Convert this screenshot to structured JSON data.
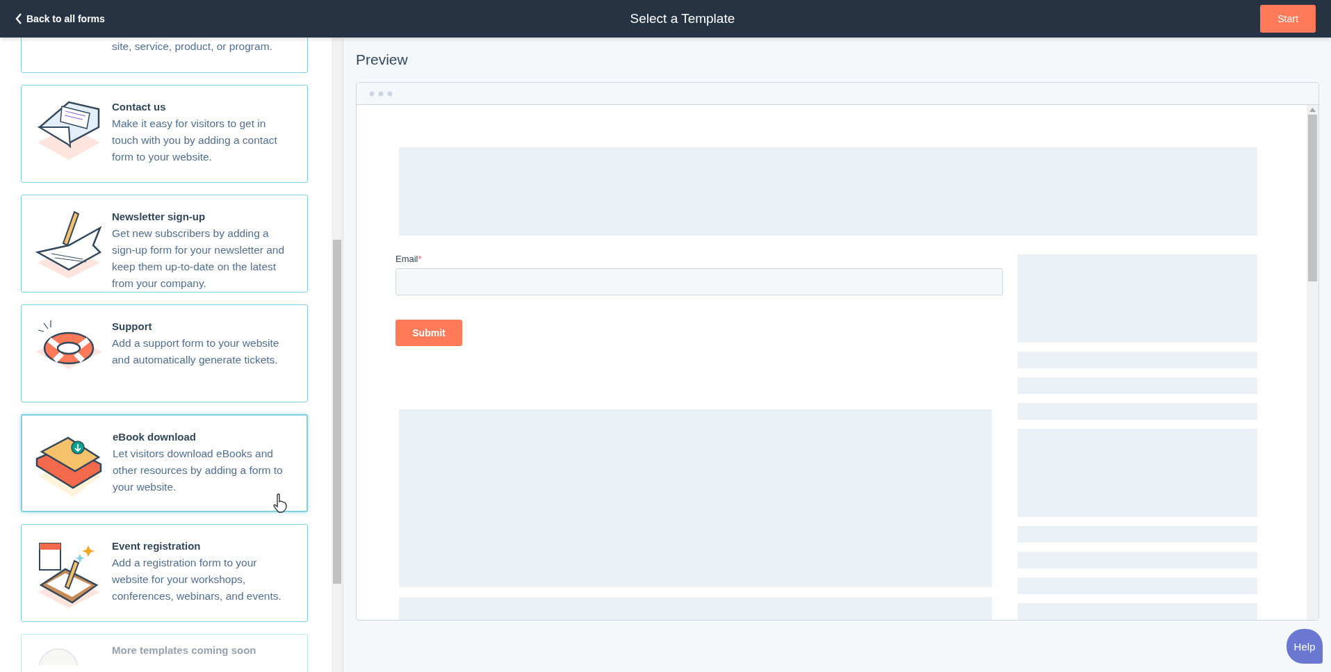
{
  "header": {
    "back_link": "Back to all forms",
    "title": "Select a Template",
    "start_button": "Start"
  },
  "templates": [
    {
      "kind": "partial",
      "description": "site, service, product, or program."
    },
    {
      "kind": "card",
      "title": "Contact us",
      "description": "Make it easy for visitors to get in touch with you by adding a contact form to your website.",
      "selected": false
    },
    {
      "kind": "card",
      "title": "Newsletter sign-up",
      "description": "Get new subscribers by adding a sign-up form for your newsletter and keep them up-to-date on the latest from your company.",
      "selected": false
    },
    {
      "kind": "card",
      "title": "Support",
      "description": "Add a support form to your website and automatically generate tickets.",
      "selected": false
    },
    {
      "kind": "card",
      "title": "eBook download",
      "description": "Let visitors download eBooks and other resources by adding a form to your website.",
      "selected": true
    },
    {
      "kind": "card",
      "title": "Event registration",
      "description": "Add a registration form to your website for your workshops, conferences, webinars, and events.",
      "selected": false
    },
    {
      "kind": "faded",
      "title": "More templates coming soon"
    }
  ],
  "preview": {
    "heading": "Preview",
    "field_label": "Email",
    "required_mark": "*",
    "submit_button": "Submit"
  },
  "help_button": "Help"
}
